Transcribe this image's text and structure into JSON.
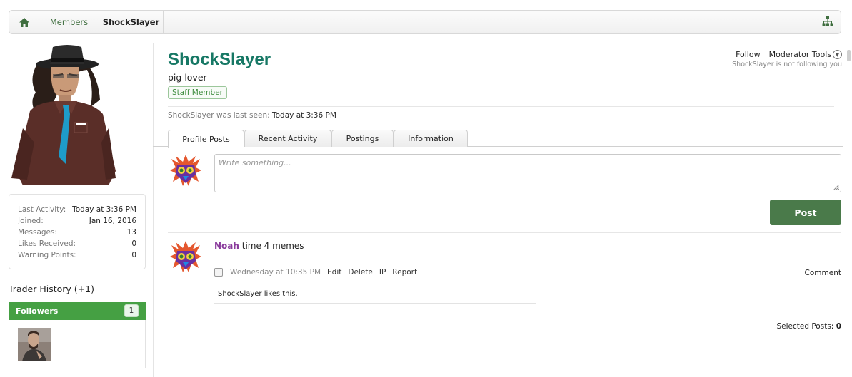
{
  "breadcrumb": {
    "home_icon": "home-icon",
    "members": "Members",
    "current": "ShockSlayer",
    "sitemap_icon": "sitemap-icon"
  },
  "profile": {
    "username": "ShockSlayer",
    "user_title": "pig lover",
    "badge": "Staff Member",
    "last_seen_prefix": "ShockSlayer was last seen:",
    "last_seen_value": "Today at 3:36 PM",
    "follow": "Follow",
    "moderator_tools": "Moderator Tools",
    "not_following": "ShockSlayer is not following you"
  },
  "stats": [
    {
      "label": "Last Activity:",
      "value": "Today at 3:36 PM"
    },
    {
      "label": "Joined:",
      "value": "Jan 16, 2016"
    },
    {
      "label": "Messages:",
      "value": "13"
    },
    {
      "label": "Likes Received:",
      "value": "0"
    },
    {
      "label": "Warning Points:",
      "value": "0"
    }
  ],
  "sidebar": {
    "trader_history": "Trader History (+1)",
    "followers_label": "Followers",
    "followers_count": "1"
  },
  "tabs": [
    {
      "label": "Profile Posts",
      "active": true
    },
    {
      "label": "Recent Activity",
      "active": false
    },
    {
      "label": "Postings",
      "active": false
    },
    {
      "label": "Information",
      "active": false
    }
  ],
  "composer": {
    "placeholder": "Write something...",
    "post_button": "Post"
  },
  "post": {
    "author": "Noah",
    "message": " time 4 memes",
    "date": "Wednesday at 10:35 PM",
    "actions": [
      "Edit",
      "Delete",
      "IP",
      "Report"
    ],
    "comment": "Comment",
    "likes": "ShockSlayer likes this."
  },
  "footer": {
    "selected_label": "Selected Posts:",
    "selected_count": "0"
  },
  "colors": {
    "accent_green": "#45a043",
    "username_teal": "#177865",
    "author_purple": "#8a3b9c",
    "post_button": "#4a7a4a"
  }
}
